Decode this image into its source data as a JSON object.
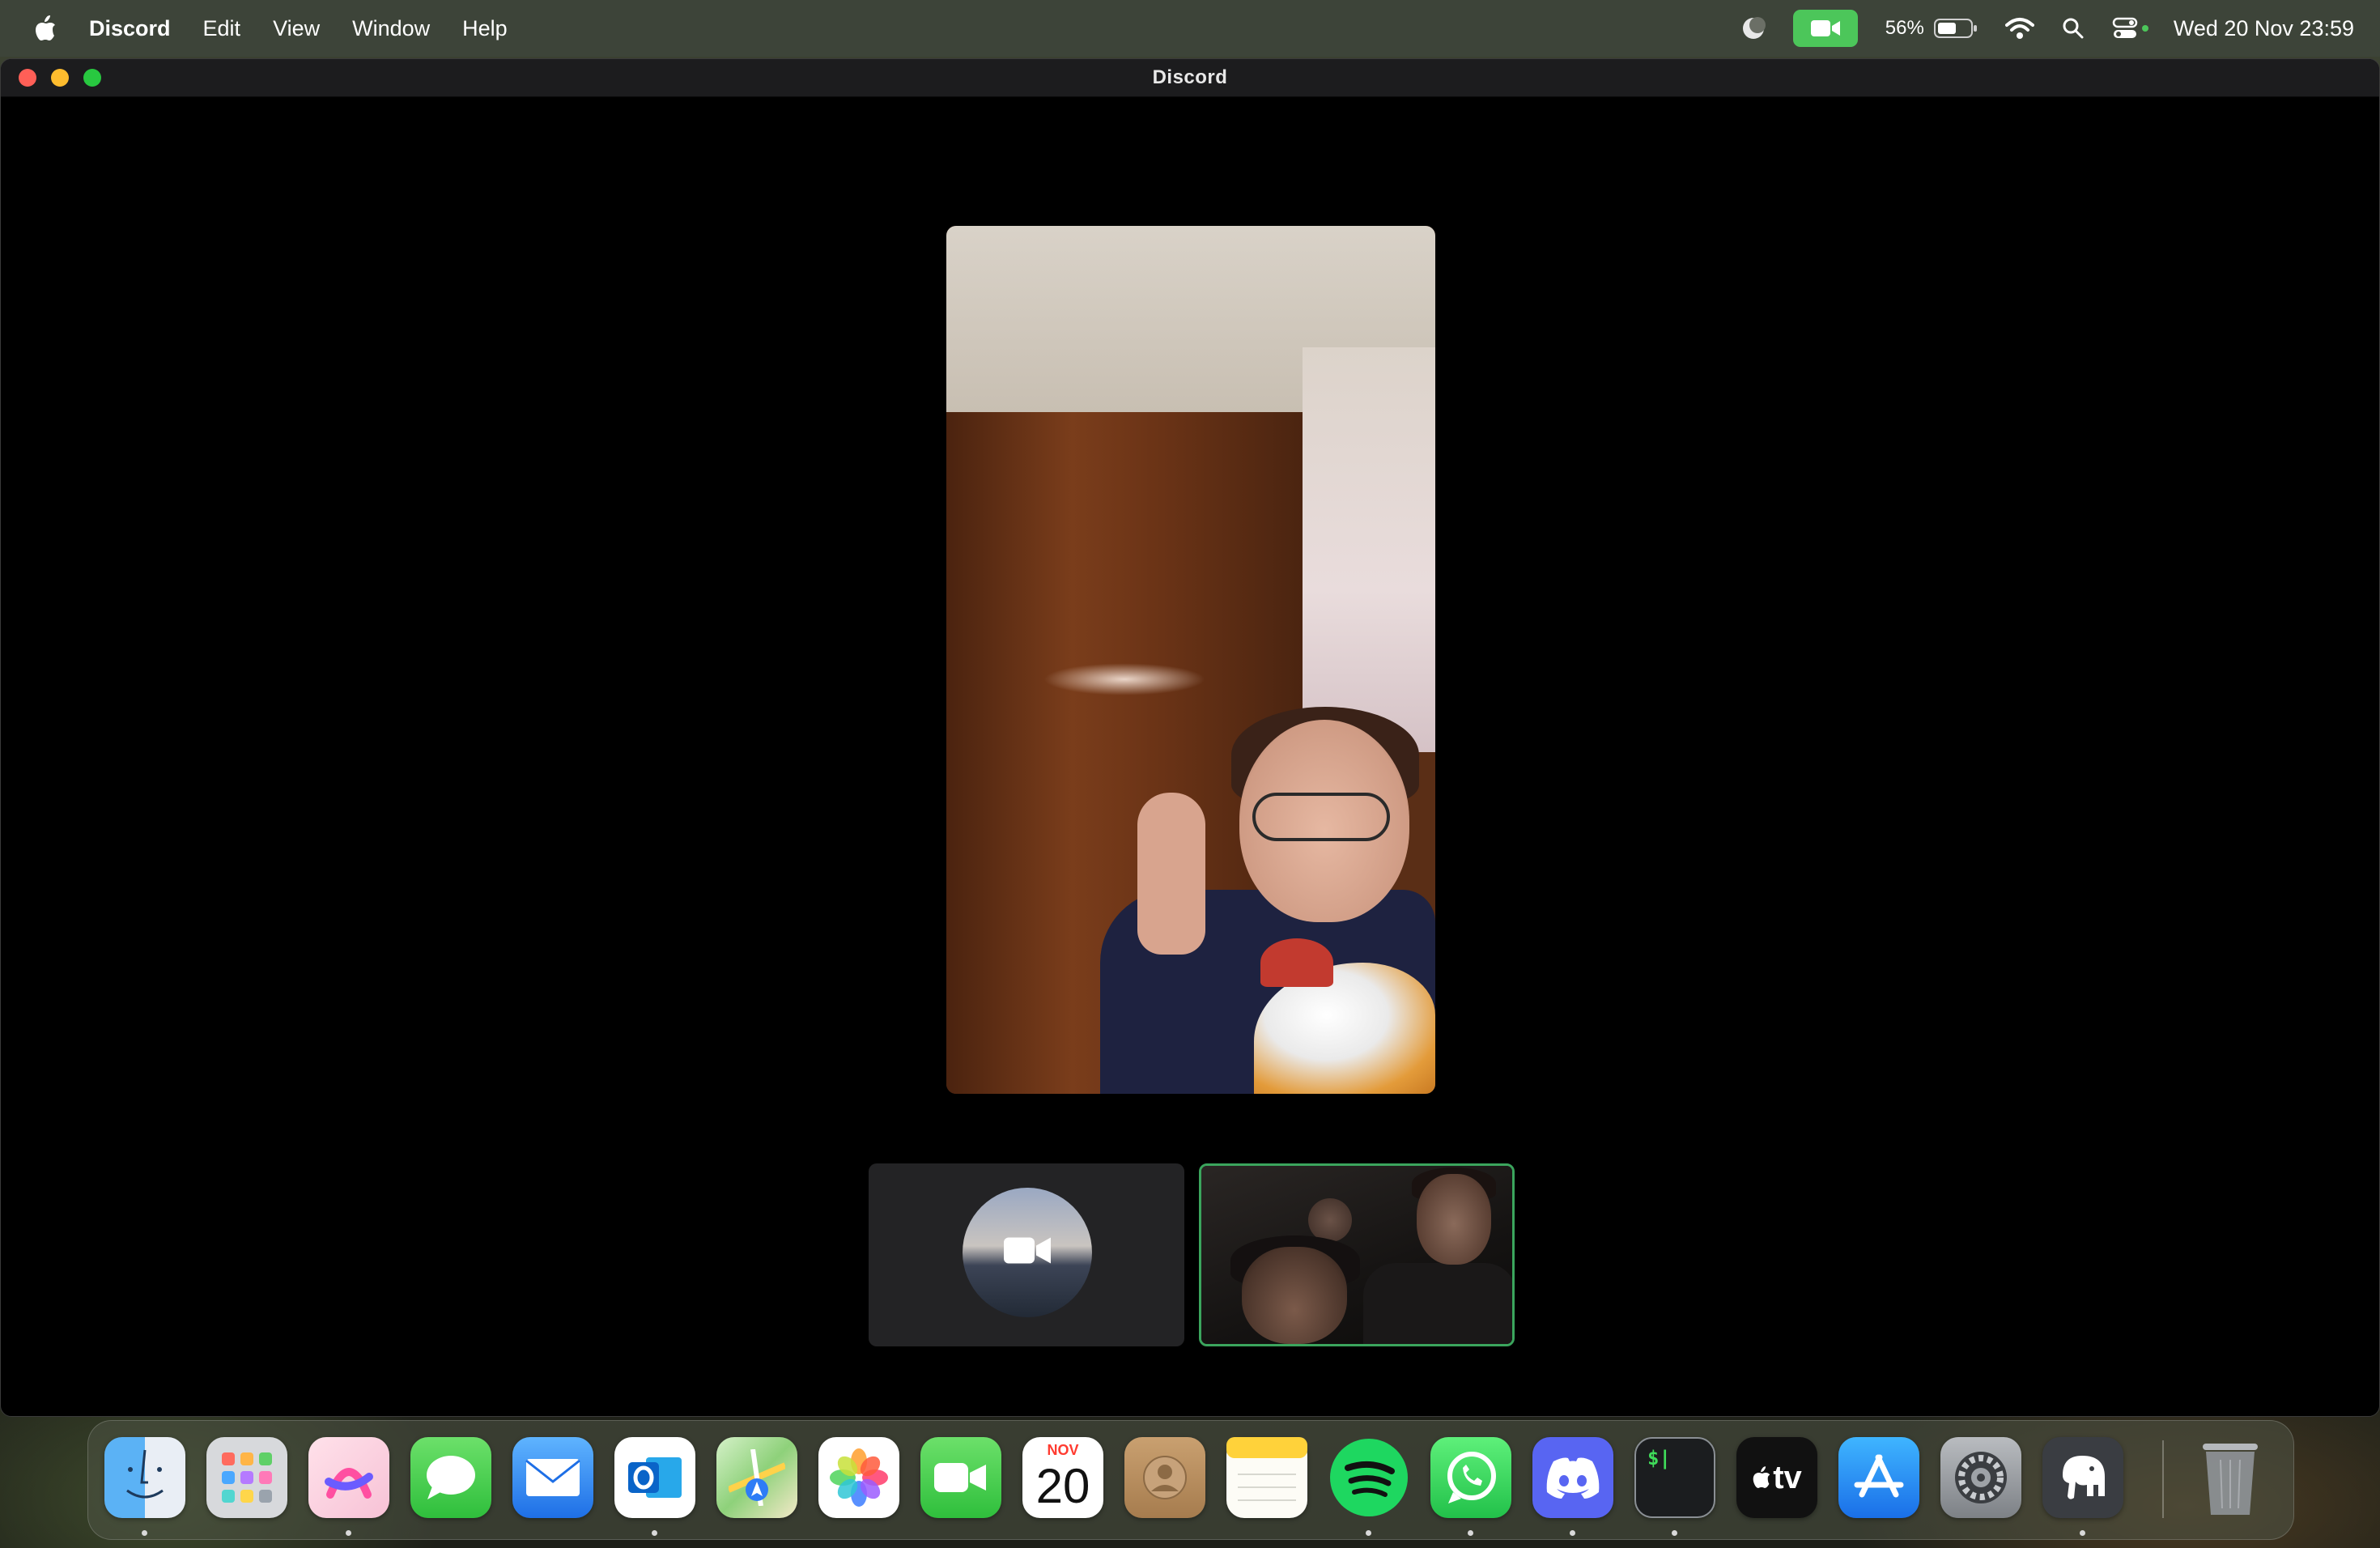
{
  "menubar": {
    "app_name": "Discord",
    "items": [
      "Edit",
      "View",
      "Window",
      "Help"
    ],
    "battery_percent": "56%",
    "clock": "Wed 20 Nov  23:59"
  },
  "window": {
    "title": "Discord"
  },
  "call": {
    "main_participant": "participant-video",
    "self_tile": "camera-off",
    "speaking_tile_color": "#3ba55d"
  },
  "dock": {
    "items": [
      {
        "name": "Finder",
        "running": true
      },
      {
        "name": "Launchpad",
        "running": false
      },
      {
        "name": "Arc",
        "running": true
      },
      {
        "name": "Messages",
        "running": false
      },
      {
        "name": "Mail",
        "running": false
      },
      {
        "name": "Outlook",
        "running": true
      },
      {
        "name": "Maps",
        "running": false
      },
      {
        "name": "Photos",
        "running": false
      },
      {
        "name": "FaceTime",
        "running": false
      },
      {
        "name": "Calendar",
        "running": false
      },
      {
        "name": "Contacts",
        "running": false
      },
      {
        "name": "Notes",
        "running": false
      },
      {
        "name": "Spotify",
        "running": true
      },
      {
        "name": "WhatsApp",
        "running": true
      },
      {
        "name": "Discord",
        "running": true
      },
      {
        "name": "Terminal",
        "running": true
      },
      {
        "name": "TV",
        "running": false
      },
      {
        "name": "App Store",
        "running": false
      },
      {
        "name": "System Settings",
        "running": false
      },
      {
        "name": "TablePlus",
        "running": true
      },
      {
        "name": "Trash",
        "running": false
      }
    ],
    "calendar_month": "NOV",
    "calendar_day": "20",
    "terminal_glyph": "$|",
    "tv_label": "tv"
  }
}
